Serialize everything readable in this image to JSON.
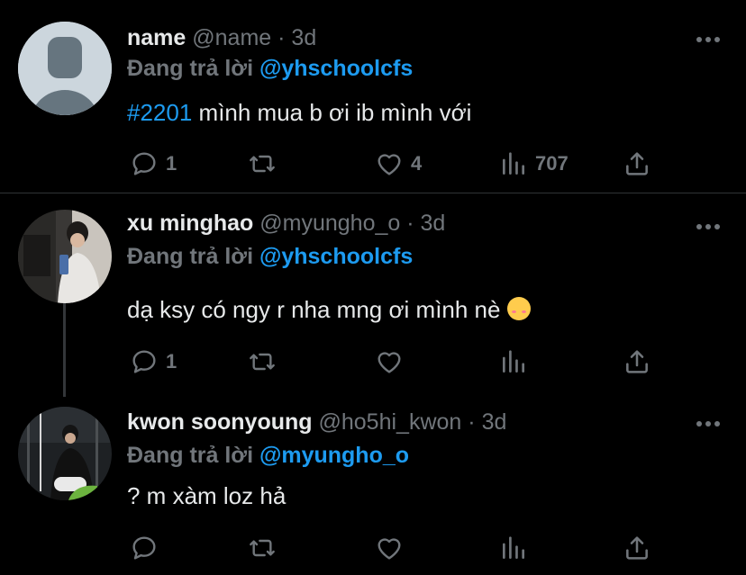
{
  "tweets": [
    {
      "name": "name",
      "handle": "@name",
      "dot": "·",
      "time": "3d",
      "reply_prefix": "Đang trả lời",
      "reply_to": "@yhschoolcfs",
      "hashtag": "#2201",
      "text": " mình mua b ơi ib mình với",
      "reply_count": "1",
      "like_count": "4",
      "view_count": "707",
      "avatar": "default-avatar"
    },
    {
      "name": "xu minghao",
      "handle": "@myungho_o",
      "dot": "·",
      "time": "3d",
      "reply_prefix": "Đang trả lời",
      "reply_to": "@yhschoolcfs",
      "text": "dạ ksy có ngy r nha mng ơi mình nè",
      "emoji": "smiling-face-with-hearts",
      "reply_count": "1",
      "avatar": "photo-avatar"
    },
    {
      "name": "kwon soonyoung",
      "handle": "@ho5hi_kwon",
      "dot": "·",
      "time": "3d",
      "reply_prefix": "Đang trả lời",
      "reply_to": "@myungho_o",
      "text": "? m xàm loz hả",
      "avatar": "photo-avatar"
    }
  ],
  "colors": {
    "background": "#000000",
    "text": "#e7e9ea",
    "muted": "#71767b",
    "accent": "#1d9bf0"
  }
}
